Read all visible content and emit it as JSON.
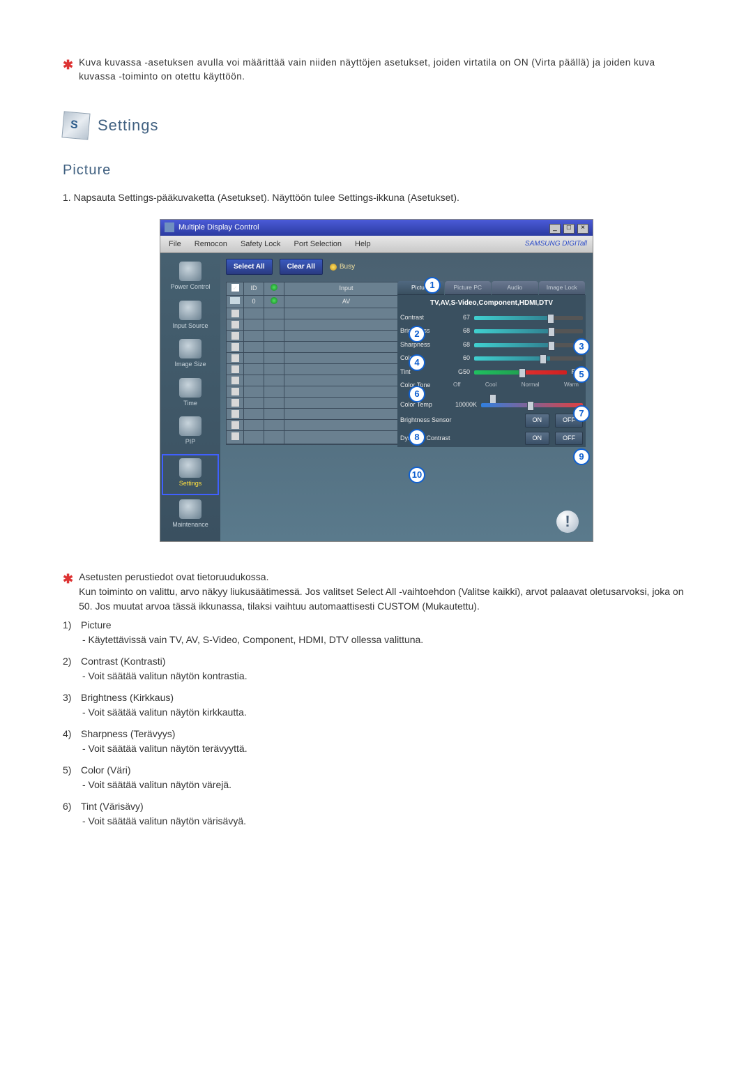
{
  "intro_note": "Kuva kuvassa -asetuksen avulla voi määrittää vain niiden näyttöjen asetukset, joiden virtatila on ON (Virta päällä) ja joiden kuva kuvassa -toiminto on otettu käyttöön.",
  "section_title": "Settings",
  "subsection_title": "Picture",
  "step1": "Napsauta Settings-pääkuvaketta (Asetukset). Näyttöön tulee Settings-ikkuna (Asetukset).",
  "win": {
    "title": "Multiple Display Control",
    "menus": {
      "file": "File",
      "remocon": "Remocon",
      "safety": "Safety Lock",
      "port": "Port Selection",
      "help": "Help"
    },
    "brand": "SAMSUNG DIGITall",
    "buttons": {
      "select_all": "Select All",
      "clear_all": "Clear All",
      "busy": "Busy"
    },
    "grid": {
      "col_id": "ID",
      "col_input": "Input",
      "row_id": "0",
      "row_input": "AV"
    },
    "sidebar": {
      "power": "Power Control",
      "input": "Input Source",
      "image": "Image Size",
      "time": "Time",
      "pip": "PIP",
      "settings": "Settings",
      "maintenance": "Maintenance"
    },
    "tabs": {
      "picture": "Picture",
      "picture_pc": "Picture PC",
      "audio": "Audio",
      "image_lock": "Image Lock"
    },
    "panel_sub": "TV,AV,S-Video,Component,HDMI,DTV",
    "controls": {
      "contrast": "Contrast",
      "contrast_val": "67",
      "brightness": "Brightness",
      "brightness_val": "68",
      "sharpness": "Sharpness",
      "sharpness_val": "68",
      "color": "Color",
      "color_val": "60",
      "tint": "Tint",
      "tint_val": "G50",
      "tint_r": "R50",
      "color_tone": "Color Tone",
      "tone_off": "Off",
      "tone_cool": "Cool",
      "tone_normal": "Normal",
      "tone_warm": "Warm",
      "color_temp": "Color Temp",
      "color_temp_val": "10000K",
      "brightness_sensor": "Brightness Sensor",
      "dynamic_contrast": "Dynamic Contrast",
      "on": "ON",
      "off": "OFF"
    }
  },
  "callouts": {
    "1": "1",
    "2": "2",
    "3": "3",
    "4": "4",
    "5": "5",
    "6": "6",
    "7": "7",
    "8": "8",
    "9": "9",
    "10": "10"
  },
  "below_note": "Asetusten perustiedot ovat tietoruudukossa.",
  "below_note2": "Kun toiminto on valittu, arvo näkyy liukusäätimessä. Jos valitset Select All -vaihtoehdon (Valitse kaikki), arvot palaavat oletusarvoksi, joka on 50. Jos muutat arvoa tässä ikkunassa, tilaksi vaihtuu automaattisesti CUSTOM (Mukautettu).",
  "items": [
    {
      "num": "1)",
      "title": "Picture",
      "sub": "- Käytettävissä vain TV, AV, S-Video, Component, HDMI, DTV ollessa valittuna."
    },
    {
      "num": "2)",
      "title": "Contrast (Kontrasti)",
      "sub": "- Voit säätää valitun näytön kontrastia."
    },
    {
      "num": "3)",
      "title": "Brightness (Kirkkaus)",
      "sub": "- Voit säätää valitun näytön kirkkautta."
    },
    {
      "num": "4)",
      "title": "Sharpness (Terävyys)",
      "sub": "- Voit säätää valitun näytön terävyyttä."
    },
    {
      "num": "5)",
      "title": "Color (Väri)",
      "sub": "- Voit säätää valitun näytön värejä."
    },
    {
      "num": "6)",
      "title": "Tint (Värisävy)",
      "sub": "- Voit säätää valitun näytön värisävyä."
    }
  ]
}
